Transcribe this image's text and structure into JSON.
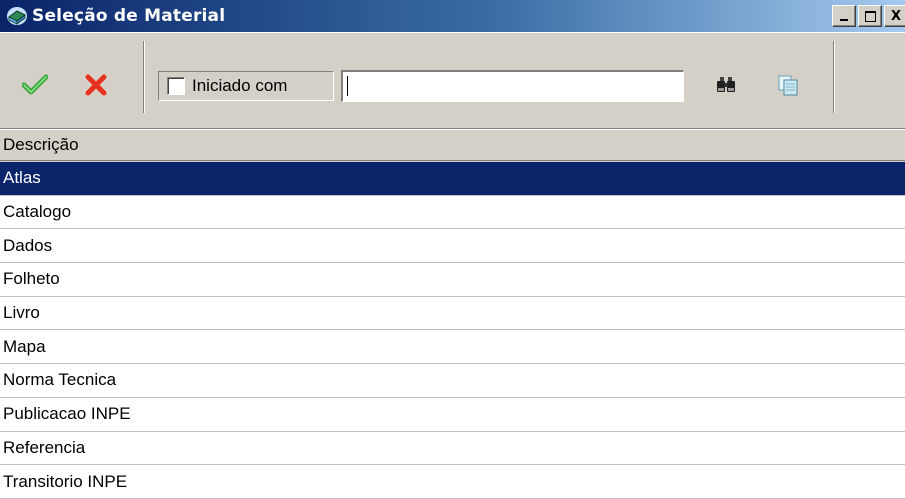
{
  "window": {
    "title": "Seleção de Material",
    "buttons": {
      "minimize": "_",
      "maximize": "□",
      "close": "X"
    }
  },
  "toolbar": {
    "confirm_icon": "check-icon",
    "cancel_icon": "x-icon",
    "starts_with_label": "Iniciado com",
    "starts_with_checked": false,
    "search_value": "",
    "find_icon": "binoculars-icon",
    "copy_icon": "copy-pages-icon"
  },
  "list": {
    "header": "Descrição",
    "selected_index": 0,
    "items": [
      "Atlas",
      "Catalogo",
      "Dados",
      "Folheto",
      "Livro",
      "Mapa",
      "Norma Tecnica",
      "Publicacao INPE",
      "Referencia",
      "Transitorio INPE"
    ]
  },
  "colors": {
    "titlebar_start": "#0a246a",
    "titlebar_end": "#a6caf0",
    "selection": "#0a246a",
    "face": "#d4d0c8"
  }
}
